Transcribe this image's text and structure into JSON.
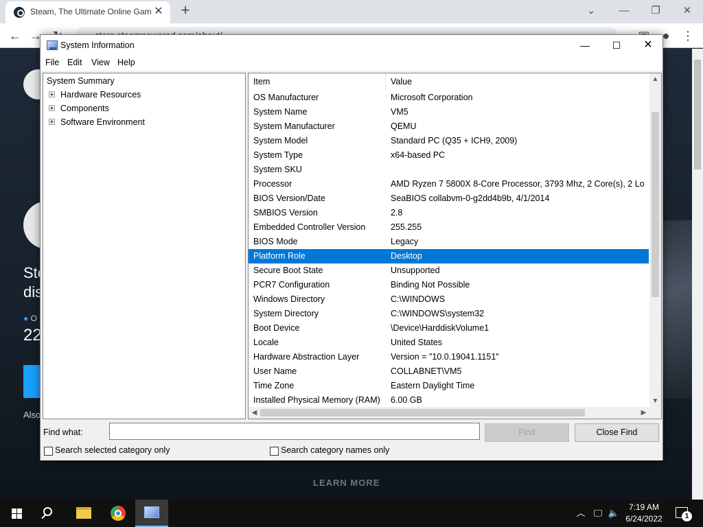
{
  "browser": {
    "tab_title": "Steam, The Ultimate Online Gam",
    "url": "store.steampowered.com/about/"
  },
  "steam_page": {
    "line1": "Ste",
    "line2": "dis",
    "online_label": "O",
    "count": "22",
    "also": "Also",
    "learn_more": "LEARN MORE"
  },
  "window": {
    "title": "System Information",
    "menu": [
      "File",
      "Edit",
      "View",
      "Help"
    ]
  },
  "tree": {
    "root": "System Summary",
    "children": [
      "Hardware Resources",
      "Components",
      "Software Environment"
    ]
  },
  "list": {
    "columns": [
      "Item",
      "Value"
    ],
    "rows": [
      {
        "item": "OS Manufacturer",
        "value": "Microsoft Corporation"
      },
      {
        "item": "System Name",
        "value": "VM5"
      },
      {
        "item": "System Manufacturer",
        "value": "QEMU"
      },
      {
        "item": "System Model",
        "value": "Standard PC (Q35 + ICH9, 2009)"
      },
      {
        "item": "System Type",
        "value": "x64-based PC"
      },
      {
        "item": "System SKU",
        "value": ""
      },
      {
        "item": "Processor",
        "value": "AMD Ryzen 7 5800X 8-Core Processor, 3793 Mhz, 2 Core(s), 2 Lo"
      },
      {
        "item": "BIOS Version/Date",
        "value": "SeaBIOS collabvm-0-g2dd4b9b, 4/1/2014"
      },
      {
        "item": "SMBIOS Version",
        "value": "2.8"
      },
      {
        "item": "Embedded Controller Version",
        "value": "255.255"
      },
      {
        "item": "BIOS Mode",
        "value": "Legacy"
      },
      {
        "item": "Platform Role",
        "value": "Desktop"
      },
      {
        "item": "Secure Boot State",
        "value": "Unsupported"
      },
      {
        "item": "PCR7 Configuration",
        "value": "Binding Not Possible"
      },
      {
        "item": "Windows Directory",
        "value": "C:\\WINDOWS"
      },
      {
        "item": "System Directory",
        "value": "C:\\WINDOWS\\system32"
      },
      {
        "item": "Boot Device",
        "value": "\\Device\\HarddiskVolume1"
      },
      {
        "item": "Locale",
        "value": "United States"
      },
      {
        "item": "Hardware Abstraction Layer",
        "value": "Version = \"10.0.19041.1151\""
      },
      {
        "item": "User Name",
        "value": "COLLABNET\\VM5"
      },
      {
        "item": "Time Zone",
        "value": "Eastern Daylight Time"
      },
      {
        "item": "Installed Physical Memory (RAM)",
        "value": "6.00 GB"
      }
    ],
    "selected_item": "Platform Role"
  },
  "find": {
    "label": "Find what:",
    "value": "",
    "find_button": "Find",
    "close_button": "Close Find",
    "opt_selected_category": "Search selected category only",
    "opt_category_names": "Search category names only"
  },
  "taskbar": {
    "time": "7:19 AM",
    "date": "6/24/2022",
    "notification_count": "1"
  },
  "colors": {
    "selection": "#0078d7",
    "taskbar": "#101010",
    "steam_bg": "#1b2838"
  }
}
